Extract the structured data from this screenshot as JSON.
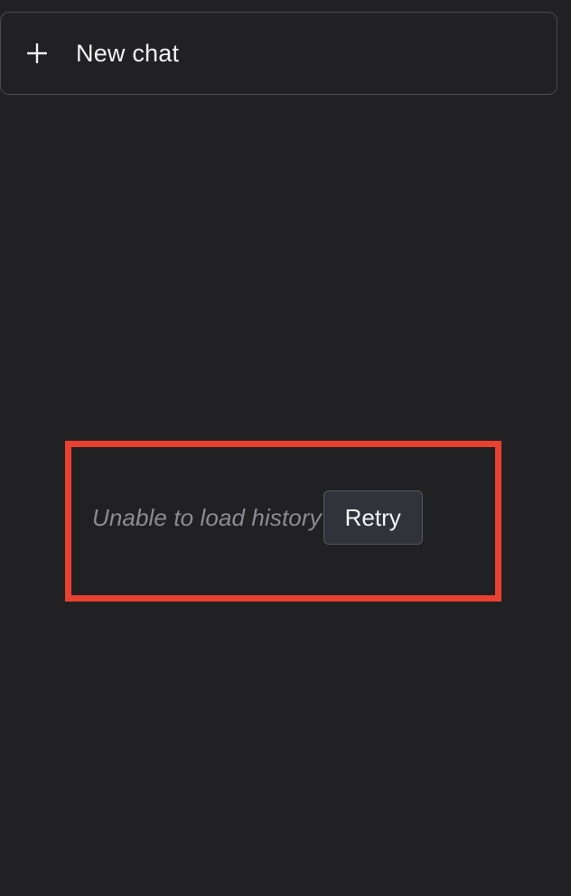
{
  "sidebar": {
    "new_chat": {
      "icon": "plus-icon",
      "label": "New chat"
    },
    "history": {
      "error_message": "Unable to load history",
      "retry_label": "Retry"
    }
  },
  "colors": {
    "background": "#212123",
    "border": "#4a4a50",
    "highlight": "#e8412f",
    "muted_text": "#8b8b92",
    "button_bg": "#32323a"
  }
}
